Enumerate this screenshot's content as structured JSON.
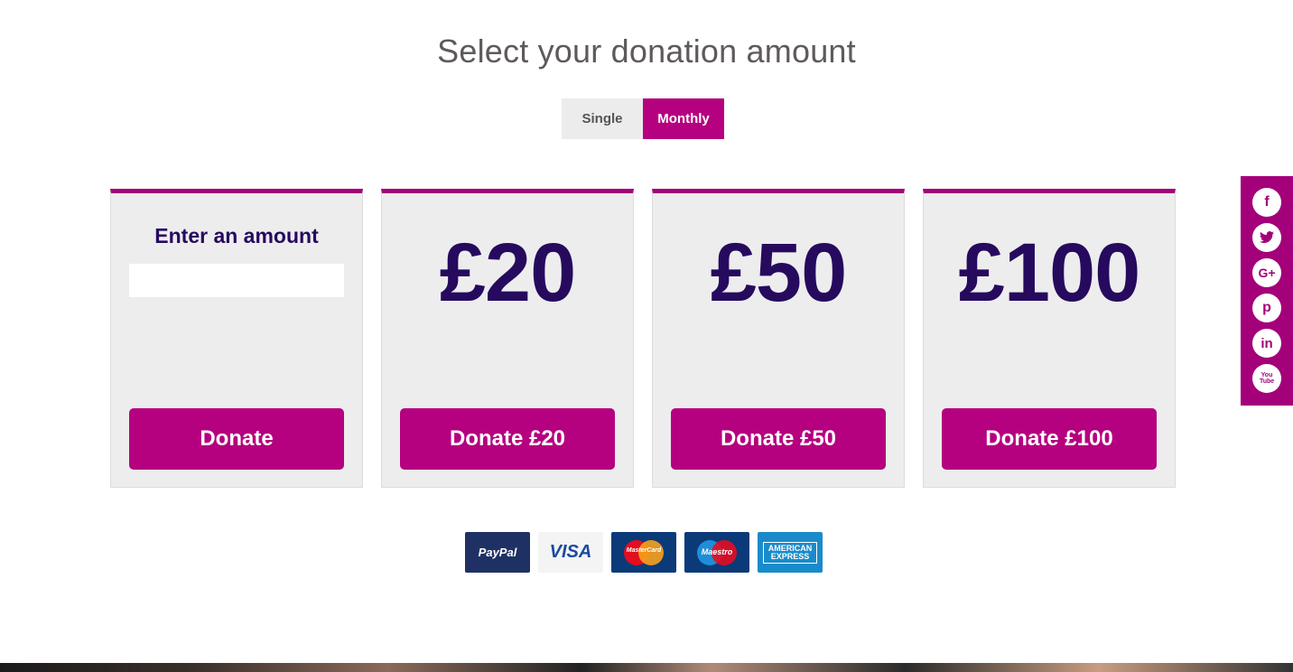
{
  "page": {
    "title": "Select your donation amount"
  },
  "frequency": {
    "options": [
      "Single",
      "Monthly"
    ],
    "selected": "Monthly"
  },
  "cards": {
    "custom": {
      "label": "Enter an amount",
      "input_value": "",
      "button_label": "Donate"
    },
    "items": [
      {
        "amount": "£20",
        "button_label": "Donate £20"
      },
      {
        "amount": "£50",
        "button_label": "Donate £50"
      },
      {
        "amount": "£100",
        "button_label": "Donate £100"
      }
    ]
  },
  "payments": {
    "paypal": "PayPal",
    "visa": "VISA",
    "mastercard": "MasterCard",
    "maestro": "Maestro",
    "amex": "AMERICAN EXPRESS"
  },
  "social": {
    "facebook": "f",
    "twitter": "t",
    "googleplus": "G+",
    "pinterest": "p",
    "linkedin": "in",
    "youtube": "You Tube"
  },
  "colors": {
    "accent": "#b5007f",
    "card_top": "#a3007a",
    "amount_text": "#260a5e",
    "card_bg": "#ededee"
  }
}
